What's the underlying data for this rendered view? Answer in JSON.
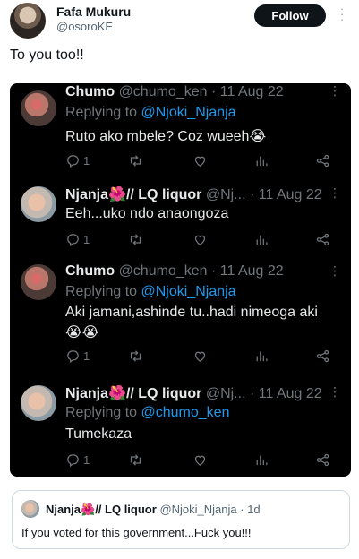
{
  "post": {
    "author_name": "Fafa Mukuru",
    "author_handle": "@osoroKE",
    "follow_label": "Follow",
    "more_icon": "more-vertical-icon",
    "text": "To you too!!"
  },
  "thread": [
    {
      "name": "Chumo",
      "handle": "@chumo_ken",
      "time": "· 11 Aug 22",
      "replying_prefix": "Replying to",
      "replying_to": "@Njoki_Njanja",
      "body": "Ruto ako mbele? Coz wueeh😭",
      "replies": "1"
    },
    {
      "name": "Njanja🌺// LQ liquor",
      "handle": "@Nj...",
      "time": "· 11 Aug 22",
      "replying_prefix": "",
      "replying_to": "",
      "body": "Eeh...uko ndo anaongoza",
      "replies": "1"
    },
    {
      "name": "Chumo",
      "handle": "@chumo_ken",
      "time": "· 11 Aug 22",
      "replying_prefix": "Replying to",
      "replying_to": "@Njoki_Njanja",
      "body": "Aki jamani,ashinde tu..hadi nimeoga aki",
      "body2": "😭😭",
      "replies": "1"
    },
    {
      "name": "Njanja🌺// LQ liquor",
      "handle": "@Nj...",
      "time": "· 11 Aug 22",
      "replying_prefix": "Replying to",
      "replying_to": "@chumo_ken",
      "body": "Tumekaza",
      "replies": "1"
    }
  ],
  "quote": {
    "name": "Njanja🌺// LQ liquor",
    "handle": "@Njoki_Njanja",
    "time": "· 1d",
    "text": "If you voted for this government...Fuck you!!!"
  },
  "colors": {
    "dark_bg": "#000000",
    "link": "#1d9bf0",
    "muted": "#71767b"
  }
}
